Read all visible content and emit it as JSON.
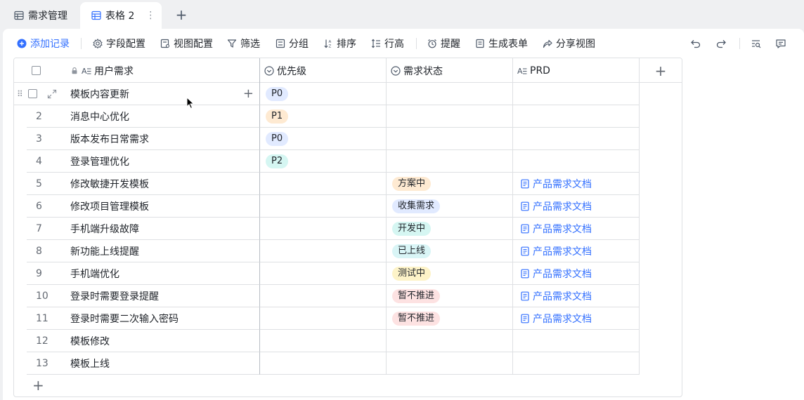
{
  "tabs": [
    {
      "label": "需求管理",
      "active": false
    },
    {
      "label": "表格 2",
      "active": true
    }
  ],
  "tab_more": "⋮",
  "toolbar": {
    "add_record": "添加记录",
    "field_config": "字段配置",
    "view_config": "视图配置",
    "filter": "筛选",
    "group": "分组",
    "sort": "排序",
    "row_height": "行高",
    "reminder": "提醒",
    "form": "生成表单",
    "share": "分享视图"
  },
  "columns": {
    "name": "用户需求",
    "priority": "优先级",
    "status": "需求状态",
    "prd": "PRD"
  },
  "rows": [
    {
      "num": "",
      "name": "模板内容更新",
      "priority": "P0",
      "status": "",
      "prd": ""
    },
    {
      "num": "2",
      "name": "消息中心优化",
      "priority": "P1",
      "status": "",
      "prd": ""
    },
    {
      "num": "3",
      "name": "版本发布日常需求",
      "priority": "P0",
      "status": "",
      "prd": ""
    },
    {
      "num": "4",
      "name": "登录管理优化",
      "priority": "P2",
      "status": "",
      "prd": ""
    },
    {
      "num": "5",
      "name": "修改敏捷开发模板",
      "priority": "",
      "status": "方案中",
      "prd": "产品需求文档"
    },
    {
      "num": "6",
      "name": "修改项目管理模板",
      "priority": "",
      "status": "收集需求",
      "prd": "产品需求文档"
    },
    {
      "num": "7",
      "name": "手机端升级故障",
      "priority": "",
      "status": "开发中",
      "prd": "产品需求文档"
    },
    {
      "num": "8",
      "name": "新功能上线提醒",
      "priority": "",
      "status": "已上线",
      "prd": "产品需求文档"
    },
    {
      "num": "9",
      "name": "手机端优化",
      "priority": "",
      "status": "测试中",
      "prd": "产品需求文档"
    },
    {
      "num": "10",
      "name": "登录时需要登录提醒",
      "priority": "",
      "status": "暂不推进",
      "prd": "产品需求文档"
    },
    {
      "num": "11",
      "name": "登录时需要二次输入密码",
      "priority": "",
      "status": "暂不推进",
      "prd": "产品需求文档"
    },
    {
      "num": "12",
      "name": "模板修改",
      "priority": "",
      "status": "",
      "prd": ""
    },
    {
      "num": "13",
      "name": "模板上线",
      "priority": "",
      "status": "",
      "prd": ""
    }
  ],
  "tag_colors": {
    "P0": "#e1eaff",
    "P1": "#feead2",
    "P2": "#d5f6f2",
    "方案中": "#feead2",
    "收集需求": "#e1eaff",
    "开发中": "#d5f6f2",
    "已上线": "#d9f5f6",
    "测试中": "#fdf3c8",
    "暂不推进": "#fde2e2"
  },
  "accent_color": "#3370ff"
}
